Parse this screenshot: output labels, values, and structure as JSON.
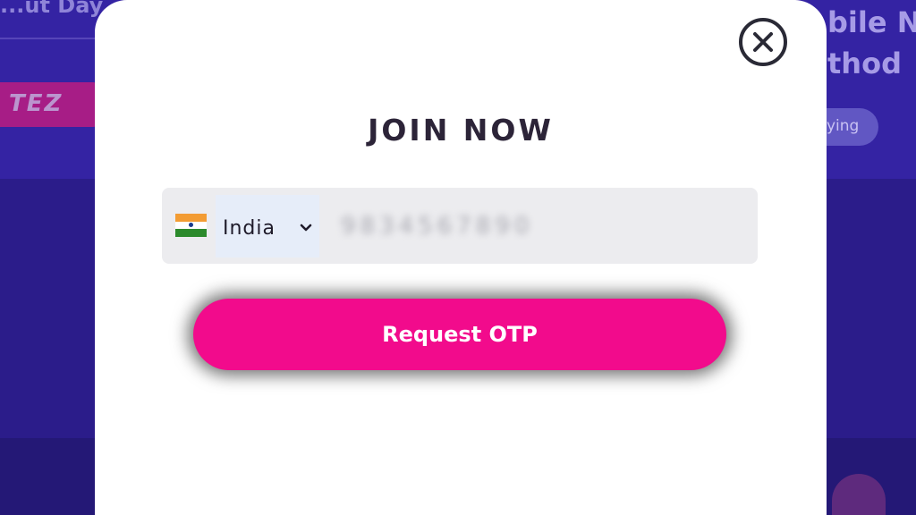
{
  "background": {
    "top_left_text": "...ut Day",
    "logo_text": "TEZ",
    "right_text_line1": "bile No",
    "right_text_line2": "thod",
    "pill_text": "ying"
  },
  "modal": {
    "title": "JOIN NOW",
    "close_icon": "close-icon",
    "phone": {
      "country_flag": "india-flag-icon",
      "country": "India",
      "dropdown_icon": "chevron-down-icon",
      "number_value": "9834567890"
    },
    "submit_label": "Request OTP"
  },
  "colors": {
    "backdrop": "#2f1f8f",
    "primary_button": "#f20b8c",
    "modal_background": "#ffffff",
    "input_background": "#ececef",
    "title_text": "#2c2438"
  }
}
